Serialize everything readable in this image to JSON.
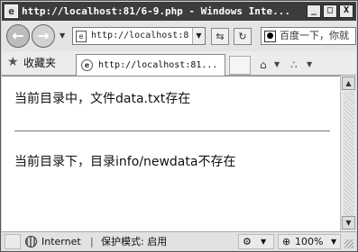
{
  "window": {
    "title": "http://localhost:81/6-9.php - Windows Inte...",
    "buttons": {
      "minimize": "_",
      "maximize": "□",
      "close": "X"
    }
  },
  "navbar": {
    "address": "http://localhost:8",
    "search_placeholder": "百度一下，你就"
  },
  "favorites": {
    "label": "收藏夹",
    "tab_title": "http://localhost:81..."
  },
  "content": {
    "line1": "当前目录中，文件data.txt存在",
    "line2": "当前目录下，目录info/newdata不存在"
  },
  "statusbar": {
    "zone": "Internet",
    "protected_mode": "保护模式: 启用",
    "zoom": "100%"
  },
  "colors": {
    "titlebar": "#3c3c3c",
    "content_bg": "#ffffff"
  }
}
